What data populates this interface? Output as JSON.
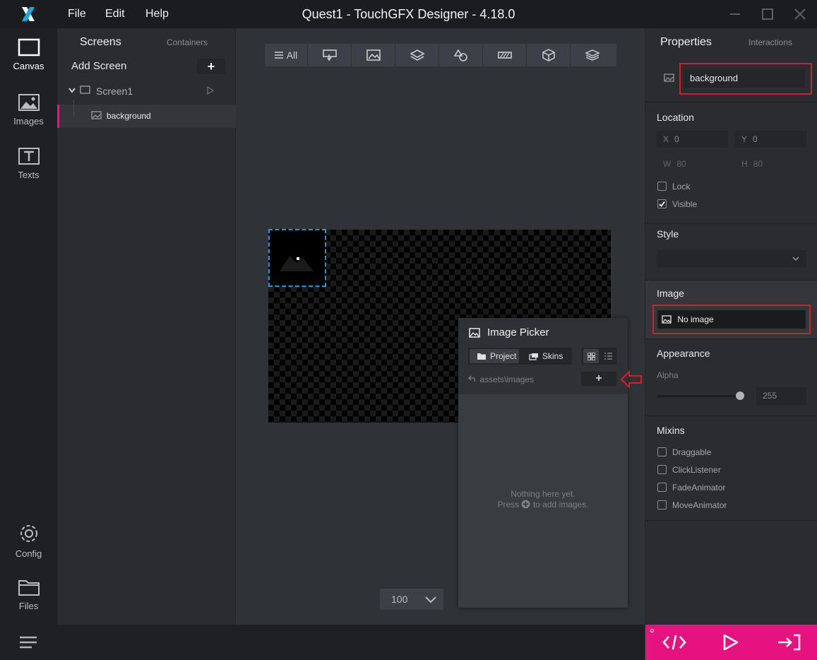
{
  "window": {
    "title": "Quest1 - TouchGFX Designer - 4.18.0",
    "menu": [
      "File",
      "Edit",
      "Help"
    ]
  },
  "rail": {
    "items": [
      {
        "label": "Canvas",
        "icon": "canvas-icon",
        "active": true
      },
      {
        "label": "Images",
        "icon": "images-icon"
      },
      {
        "label": "Texts",
        "icon": "texts-icon"
      },
      {
        "label": "Config",
        "icon": "gear-icon"
      },
      {
        "label": "Files",
        "icon": "folder-icon"
      }
    ]
  },
  "screens_panel": {
    "tab_active": "Screens",
    "tab_inactive": "Containers",
    "add_screen_label": "Add Screen",
    "add_button": "+",
    "screen_name": "Screen1",
    "widget_name": "background"
  },
  "toolbar": {
    "all_label": "All",
    "tools": [
      "interaction-icon",
      "image-icon",
      "layers-icon",
      "shapes-icon",
      "progress-icon",
      "3d-box-icon",
      "stack-icon"
    ]
  },
  "canvas": {
    "zoom_value": "100"
  },
  "image_picker": {
    "title": "Image Picker",
    "tab_project": "Project",
    "tab_skins": "Skins",
    "path": "assets\\images",
    "add_button": "+",
    "empty_line1": "Nothing here yet.",
    "empty_line2_pre": "Press",
    "empty_line2_post": "to add images."
  },
  "properties": {
    "tab_active": "Properties",
    "tab_inactive": "Interactions",
    "name_value": "background",
    "location": {
      "title": "Location",
      "x_label": "X",
      "x_value": "0",
      "y_label": "Y",
      "y_value": "0",
      "w_label": "W",
      "w_value": "80",
      "h_label": "H",
      "h_value": "80",
      "lock_label": "Lock",
      "lock_checked": false,
      "visible_label": "Visible",
      "visible_checked": true
    },
    "style": {
      "title": "Style",
      "value": ""
    },
    "image": {
      "title": "Image",
      "value": "No image"
    },
    "appearance": {
      "title": "Appearance",
      "alpha_label": "Alpha",
      "alpha_value": "255",
      "alpha_fraction": 1.0
    },
    "mixins": {
      "title": "Mixins",
      "items": [
        {
          "label": "Draggable",
          "checked": false
        },
        {
          "label": "ClickListener",
          "checked": false
        },
        {
          "label": "FadeAnimator",
          "checked": false
        },
        {
          "label": "MoveAnimator",
          "checked": false
        }
      ]
    }
  },
  "colors": {
    "accent": "#e5127f",
    "highlight_red": "#e0182a",
    "selection_blue": "#1e9be0"
  }
}
